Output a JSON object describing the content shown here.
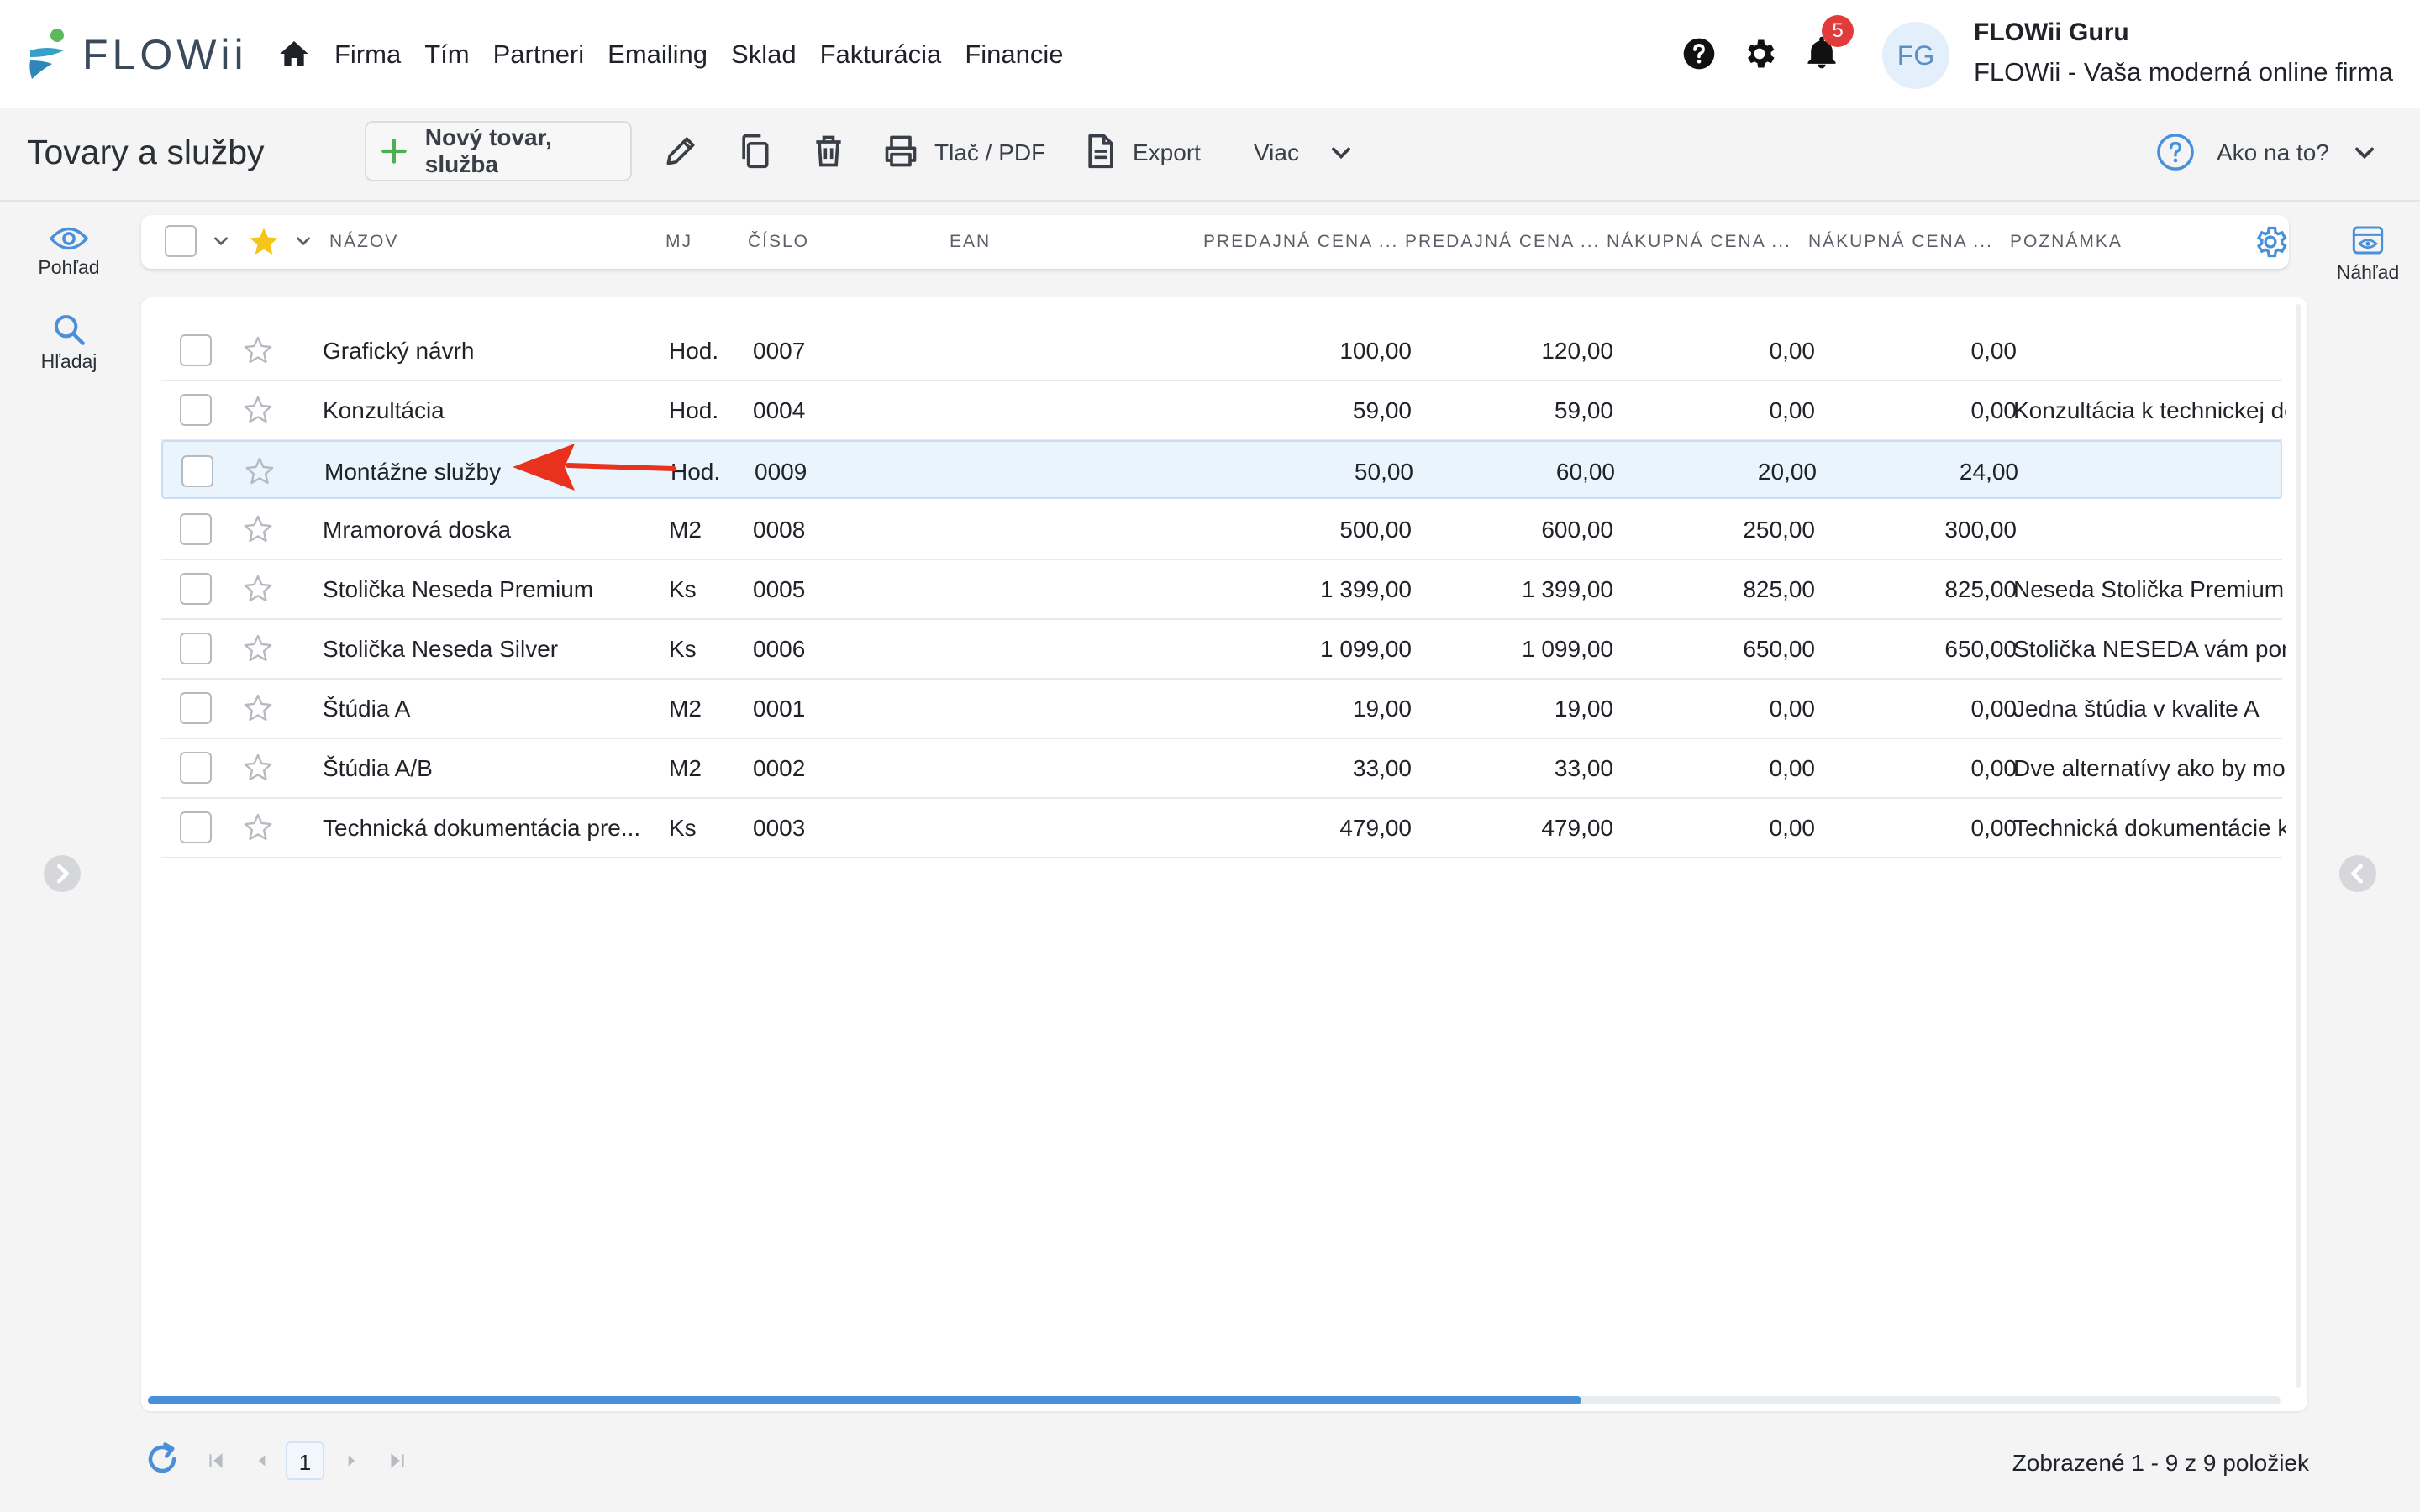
{
  "brand": {
    "name": "FLOWii"
  },
  "nav": [
    "Firma",
    "Tím",
    "Partneri",
    "Emailing",
    "Sklad",
    "Fakturácia",
    "Financie"
  ],
  "notifications": {
    "count": "5"
  },
  "user": {
    "initials": "FG",
    "name": "FLOWii Guru",
    "company": "FLOWii - Vaša moderná online firma"
  },
  "toolbar": {
    "title": "Tovary a služby",
    "new_label": "Nový tovar, služba",
    "print_label": "Tlač / PDF",
    "export_label": "Export",
    "more_label": "Viac",
    "help_label": "Ako na to?"
  },
  "sidebar": {
    "view_label": "Pohľad",
    "search_label": "Hľadaj",
    "preview_label": "Náhľad"
  },
  "columns": {
    "name": "NÁZOV",
    "unit": "MJ",
    "number": "ČÍSLO",
    "ean": "EAN",
    "sell1": "PREDAJNÁ CENA ...",
    "sell2": "PREDAJNÁ CENA ...",
    "buy1": "NÁKUPNÁ CENA ...",
    "buy2": "NÁKUPNÁ CENA ...",
    "note": "POZNÁMKA"
  },
  "rows": [
    {
      "name": "Grafický návrh",
      "unit": "Hod.",
      "number": "0007",
      "sell1": "100,00",
      "sell2": "120,00",
      "buy1": "0,00",
      "buy2": "0,00",
      "note": ""
    },
    {
      "name": "Konzultácia",
      "unit": "Hod.",
      "number": "0004",
      "sell1": "59,00",
      "sell2": "59,00",
      "buy1": "0,00",
      "buy2": "0,00",
      "note": "Konzultácia k technickej do"
    },
    {
      "name": "Montážne služby",
      "unit": "Hod.",
      "number": "0009",
      "sell1": "50,00",
      "sell2": "60,00",
      "buy1": "20,00",
      "buy2": "24,00",
      "note": ""
    },
    {
      "name": "Mramorová doska",
      "unit": "M2",
      "number": "0008",
      "sell1": "500,00",
      "sell2": "600,00",
      "buy1": "250,00",
      "buy2": "300,00",
      "note": ""
    },
    {
      "name": "Stolička Neseda Premium",
      "unit": "Ks",
      "number": "0005",
      "sell1": "1 399,00",
      "sell2": "1 399,00",
      "buy1": "825,00",
      "buy2": "825,00",
      "note": "Neseda Stolička Premium -"
    },
    {
      "name": "Stolička Neseda Silver",
      "unit": "Ks",
      "number": "0006",
      "sell1": "1 099,00",
      "sell2": "1 099,00",
      "buy1": "650,00",
      "buy2": "650,00",
      "note": "Stolička NESEDA vám pom"
    },
    {
      "name": "Štúdia A",
      "unit": "M2",
      "number": "0001",
      "sell1": "19,00",
      "sell2": "19,00",
      "buy1": "0,00",
      "buy2": "0,00",
      "note": "Jedna štúdia v kvalite A"
    },
    {
      "name": "Štúdia A/B",
      "unit": "M2",
      "number": "0002",
      "sell1": "33,00",
      "sell2": "33,00",
      "buy1": "0,00",
      "buy2": "0,00",
      "note": "Dve alternatívy ako by moh"
    },
    {
      "name": "Technická dokumentácia pre...",
      "unit": "Ks",
      "number": "0003",
      "sell1": "479,00",
      "sell2": "479,00",
      "buy1": "0,00",
      "buy2": "0,00",
      "note": "Technická dokumentácie k"
    }
  ],
  "pagination": {
    "current": "1",
    "info": "Zobrazené 1 - 9 z 9 položiek"
  },
  "colors": {
    "accent": "#4a90d9",
    "badge": "#e23b3b",
    "plus": "#4caf50",
    "star": "#f5c518",
    "annotation": "#e8321e"
  }
}
